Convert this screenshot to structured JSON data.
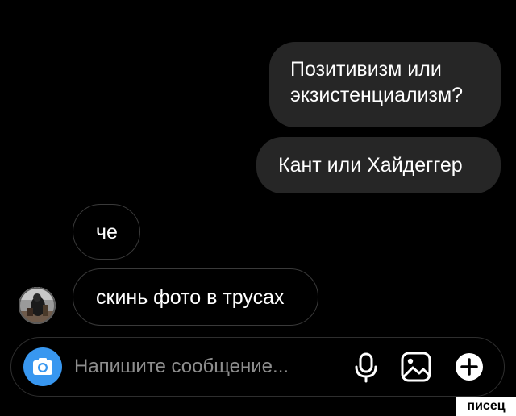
{
  "chat": {
    "messages": [
      {
        "direction": "outgoing",
        "text": "Позитивизм или экзистенциализм?"
      },
      {
        "direction": "outgoing",
        "text": "Кант или Хайдеггер"
      },
      {
        "direction": "incoming",
        "text": "че"
      },
      {
        "direction": "incoming",
        "text": "скинь фото в трусах"
      }
    ]
  },
  "composer": {
    "placeholder": "Напишите сообщение...",
    "icons": {
      "camera": "camera-icon",
      "mic": "microphone-icon",
      "gallery": "gallery-icon",
      "more": "plus-icon"
    },
    "accent_color": "#3897f0"
  },
  "watermark": {
    "text": "писец"
  }
}
